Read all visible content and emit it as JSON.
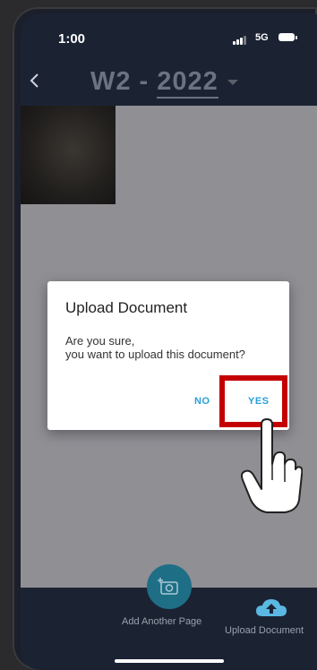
{
  "status_bar": {
    "time": "1:00",
    "network": "5G"
  },
  "header": {
    "title_prefix": "W2 - ",
    "title_year": "2022"
  },
  "dialog": {
    "title": "Upload Document",
    "message_line1": "Are you sure,",
    "message_line2": "you want to upload this document?",
    "no_label": "NO",
    "yes_label": "YES"
  },
  "bottom_bar": {
    "add_page_label": "Add Another Page",
    "upload_label": "Upload Document"
  },
  "colors": {
    "accent": "#2aa0d8",
    "highlight": "#c40000",
    "fab": "#1e6e86",
    "background": "#1b2333"
  }
}
